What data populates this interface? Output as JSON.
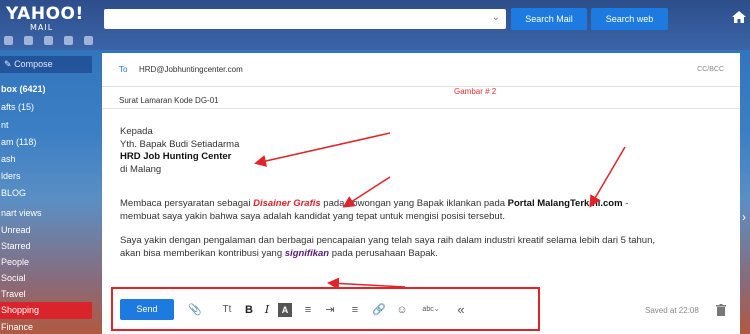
{
  "header": {
    "logo_text": "YAHOO!",
    "logo_sub": "MAIL",
    "search_placeholder": "",
    "search_mail_label": "Search Mail",
    "search_web_label": "Search web"
  },
  "sidebar": {
    "compose_label": "Compose",
    "items": [
      {
        "label": "box (6421)",
        "bold": true
      },
      {
        "label": "afts (15)"
      },
      {
        "label": "nt"
      },
      {
        "label": "am (118)"
      },
      {
        "label": "ash"
      },
      {
        "label": "lders"
      },
      {
        "label": "BLOG"
      },
      {
        "label": "nart views"
      },
      {
        "label": "Unread"
      },
      {
        "label": "Starred"
      },
      {
        "label": "People"
      },
      {
        "label": "Social"
      },
      {
        "label": "Travel"
      },
      {
        "label": "Shopping"
      },
      {
        "label": "Finance"
      }
    ]
  },
  "compose": {
    "to_label": "To",
    "to_value": "HRD@Jobhuntingcenter.com",
    "cc_bcc_label": "CC/BCC",
    "subject_value": "Surat Lamaran Kode DG-01",
    "annotation_label": "Gambar # 2",
    "body": {
      "line1": "Kepada",
      "line2": "Yth. Bapak Budi Setiadarma",
      "line3": "HRD Job Hunting Center",
      "line4": "di Malang",
      "p1_a": "Membaca persyaratan sebagai ",
      "p1_em": "Disainer Grafis",
      "p1_b": " pada Lowongan yang Bapak iklankan pada ",
      "p1_strong": "Portal MalangTerkini.com",
      "p1_c": " -",
      "p1_line2": "membuat saya yakin bahwa saya adalah kandidat yang tepat untuk mengisi posisi tersebut.",
      "p2_line1": "Saya yakin dengan pengalaman dan berbagai pencapaian yang telah saya raih dalam industri kreatif selama lebih dari 5 tahun,",
      "p2_a": "akan bisa memberikan kontribusi yang ",
      "p2_em": "signifikan",
      "p2_b": " pada perusahaan Bapak."
    },
    "send_label": "Send",
    "saved_text": "Saved at 22:08"
  },
  "colors": {
    "accent": "#1d7ae0",
    "annotation_red": "#e0242a"
  }
}
